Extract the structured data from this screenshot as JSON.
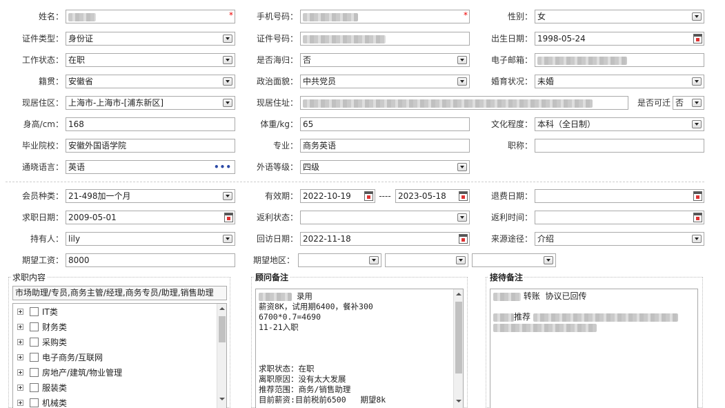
{
  "personal": {
    "name_label": "姓名：",
    "phone_label": "手机号码：",
    "gender_label": "性别：",
    "gender": "女",
    "idtype_label": "证件类型：",
    "idtype": "身份证",
    "idno_label": "证件号码：",
    "birth_label": "出生日期：",
    "birth": "1998-05-24",
    "workstatus_label": "工作状态：",
    "workstatus": "在职",
    "overseas_label": "是否海归：",
    "overseas": "否",
    "email_label": "电子邮箱：",
    "origin_label": "籍贯：",
    "origin": "安徽省",
    "political_label": "政治面貌：",
    "political": "中共党员",
    "marital_label": "婚育状况：",
    "marital": "未婚",
    "region_label": "现居住区：",
    "region": "上海市-上海市-[浦东新区]",
    "address_label": "现居住址：",
    "relocate_label": "是否可迁",
    "relocate": "否",
    "height_label": "身高/cm：",
    "height": "168",
    "weight_label": "体重/kg：",
    "weight": "65",
    "education_label": "文化程度：",
    "education": "本科（全日制）",
    "school_label": "毕业院校：",
    "school": "安徽外国语学院",
    "major_label": "专业：",
    "major": "商务英语",
    "title_label": "职称：",
    "title": "",
    "language_label": "通晓语言：",
    "language": "英语",
    "langlevel_label": "外语等级：",
    "langlevel": "四级"
  },
  "membership": {
    "type_label": "会员种类：",
    "type": "21-498加一个月",
    "valid_label": "有效期：",
    "valid_from": "2022-10-19",
    "valid_sep": "----",
    "valid_to": "2023-05-18",
    "refund_date_label": "退费日期：",
    "apply_date_label": "求职日期：",
    "apply_date": "2009-05-01",
    "rebate_status_label": "返利状态：",
    "rebate_time_label": "返利时间：",
    "holder_label": "持有人：",
    "holder": "lily",
    "visit_date_label": "回访日期：",
    "visit_date": "2022-11-18",
    "source_label": "来源途径：",
    "source": "介绍",
    "salary_label": "期望工资：",
    "salary": "8000",
    "area_label": "期望地区："
  },
  "job_section": {
    "legend": "求职内容",
    "selected": "市场助理/专员,商务主管/经理,商务专员/助理,销售助理",
    "categories": [
      "IT类",
      "财务类",
      "采购类",
      "电子商务/互联网",
      "房地产/建筑/物业管理",
      "服装类",
      "机械类"
    ]
  },
  "advisor_section": {
    "legend": "顾问备注",
    "lines": [
      {
        "text": "录用"
      },
      {
        "text": "薪资8K，试用期6400，餐补300"
      },
      {
        "text": "6700*0.7=4690"
      },
      {
        "text": "11-21入职"
      },
      {
        "text": ""
      },
      {
        "text": ""
      },
      {
        "text": ""
      },
      {
        "text": "求职状态：在职"
      },
      {
        "text": "离职原因：没有太大发展"
      },
      {
        "text": "推荐范围：商务/销售助理"
      },
      {
        "text": "目前薪资:目前税前6500   期望8k"
      }
    ]
  },
  "reception_section": {
    "legend": "接待备注",
    "line1": "转账  协议已回传",
    "line2": "推荐"
  },
  "colors": {
    "required_star": "#e00000",
    "ellipsis": "#2b49a6",
    "calendar_marker": "#dd3333"
  },
  "icons": {
    "dropdown": "chevron-down-icon",
    "date": "calendar-icon",
    "expand": "plus-square-icon",
    "more": "ellipsis-icon"
  }
}
